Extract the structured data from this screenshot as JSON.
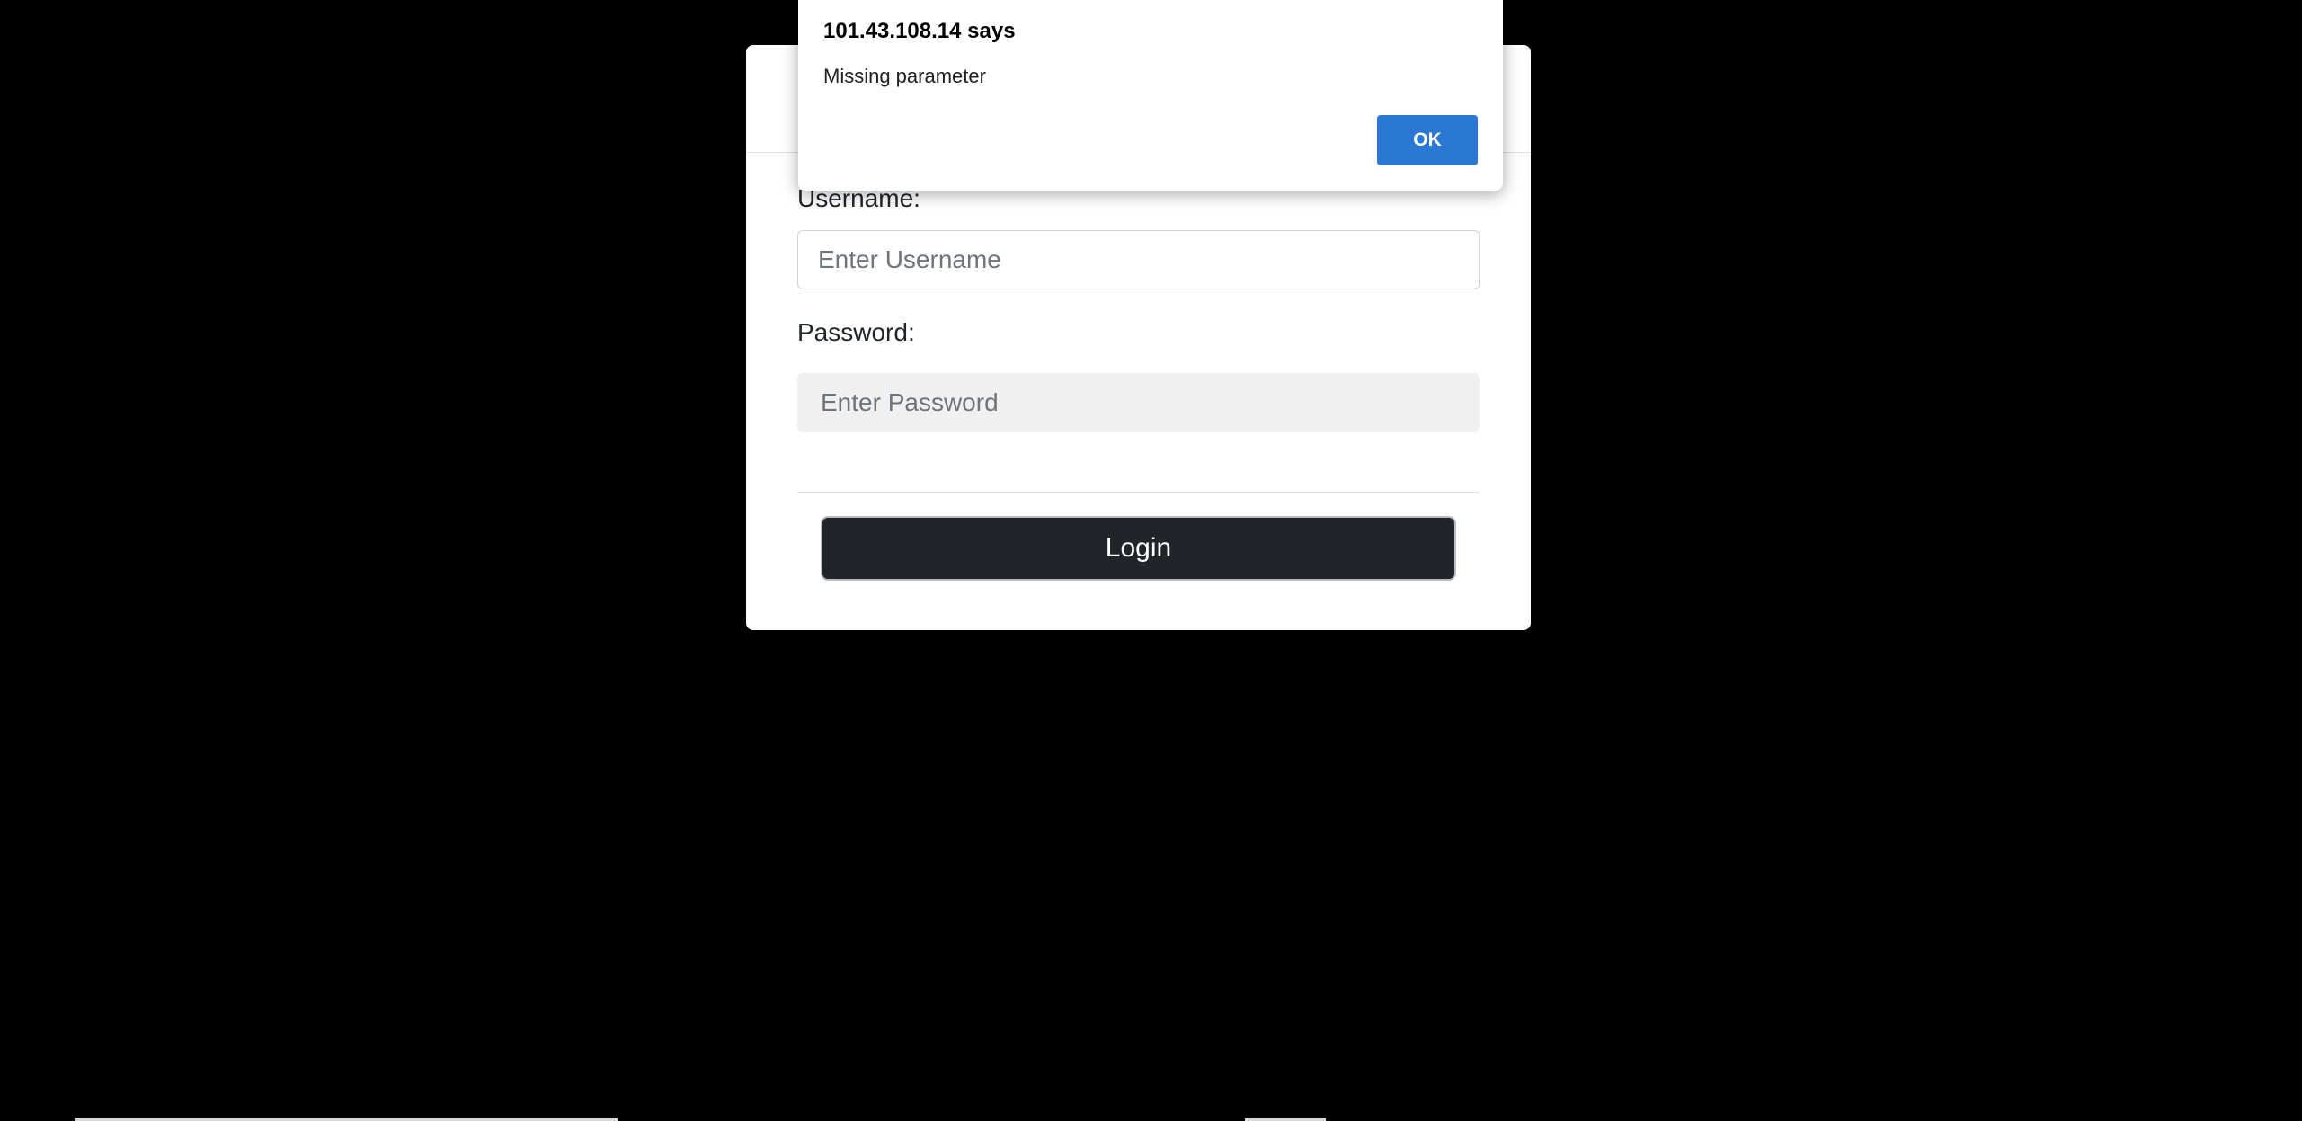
{
  "alert": {
    "title": "101.43.108.14 says",
    "message": "Missing parameter",
    "ok_label": "OK"
  },
  "login_form": {
    "username_label": "Username:",
    "username_placeholder": "Enter Username",
    "username_value": "",
    "password_label": "Password:",
    "password_placeholder": "Enter Password",
    "password_value": "",
    "login_button_label": "Login"
  },
  "colors": {
    "background": "#000000",
    "modal_background": "#ffffff",
    "login_button": "#212529",
    "alert_ok_button": "#2b78d4"
  }
}
